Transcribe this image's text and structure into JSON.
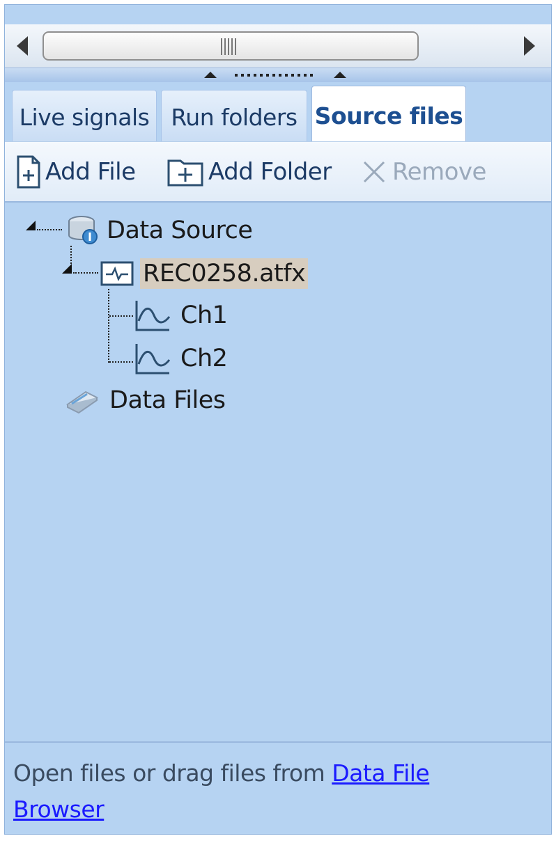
{
  "scrollbar": {
    "left_arrow": "scroll-left",
    "right_arrow": "scroll-right"
  },
  "tabs": [
    {
      "label": "Live signals",
      "active": false
    },
    {
      "label": "Run folders",
      "active": false
    },
    {
      "label": "Source files",
      "active": true
    }
  ],
  "toolbar": {
    "add_file": "Add File",
    "add_folder": "Add Folder",
    "remove": "Remove"
  },
  "tree": {
    "root": "Data Source",
    "file": "REC0258.atfx",
    "channels": [
      "Ch1",
      "Ch2"
    ],
    "data_files": "Data Files"
  },
  "footer": {
    "text": "Open files or drag files from ",
    "link_part1": "Data File",
    "link_part2": "Browser"
  },
  "colors": {
    "panel_bg": "#b6d3f2",
    "active_tab_text": "#1d4f91",
    "link": "#1a1aff",
    "selection": "#d7cdbf"
  }
}
